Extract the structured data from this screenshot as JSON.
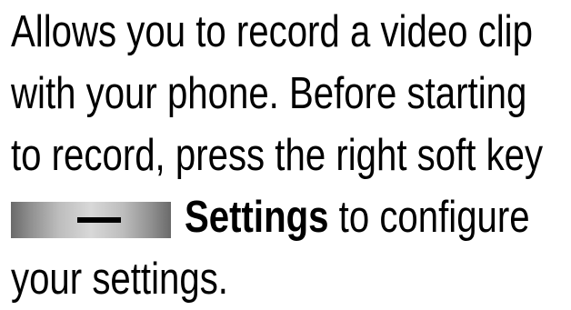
{
  "document": {
    "lines": [
      "Allows you to record a video clip",
      "with your phone. Before starting",
      "to record, press the right soft key"
    ],
    "line4_bold": "Settings",
    "line4_rest": " to configure",
    "line5": "your settings.",
    "softkey_icon": "minus-softkey-icon"
  }
}
